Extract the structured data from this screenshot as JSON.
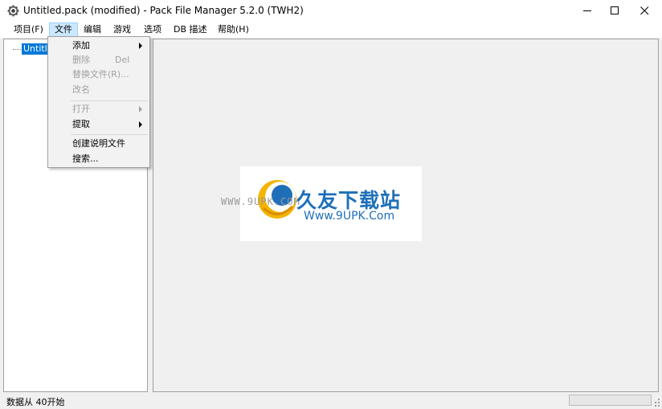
{
  "window": {
    "title": "Untitled.pack (modified) - Pack File Manager 5.2.0 (TWH2)",
    "app_icon": "cog-icon",
    "controls": {
      "minimize": "minimize-icon",
      "maximize": "maximize-icon",
      "close": "close-icon"
    }
  },
  "menubar": {
    "items": [
      {
        "label": "项目(F)"
      },
      {
        "label": "文件",
        "active": true
      },
      {
        "label": "编辑"
      },
      {
        "label": "游戏"
      },
      {
        "label": "选项"
      },
      {
        "label": "DB 描述"
      },
      {
        "label": "帮助(H)"
      }
    ]
  },
  "file_menu": {
    "items": [
      {
        "label": "添加",
        "submenu": true,
        "enabled": true
      },
      {
        "label": "删除",
        "shortcut": "Del",
        "enabled": false
      },
      {
        "label": "替换文件(R)...",
        "enabled": false
      },
      {
        "label": "改名",
        "enabled": false
      },
      {
        "label": "打开",
        "submenu": true,
        "enabled": false
      },
      {
        "label": "提取",
        "submenu": true,
        "enabled": true
      },
      {
        "label": "创建说明文件",
        "enabled": true
      },
      {
        "label": "搜索...",
        "enabled": true
      }
    ]
  },
  "tree": {
    "root": {
      "label": "Untitled.pack",
      "selected": true
    }
  },
  "watermark": {
    "brand": "久友下载站",
    "url": "Www.9UPK.Com",
    "faint": "WWW.9UPK.COM"
  },
  "statusbar": {
    "text": "数据从 40开始",
    "progress": 0
  },
  "colors": {
    "selection": "#0078d7",
    "menu_hover": "#cce8ff",
    "brand_blue": "#1e6fb8",
    "brand_yellow": "#f5b400"
  }
}
